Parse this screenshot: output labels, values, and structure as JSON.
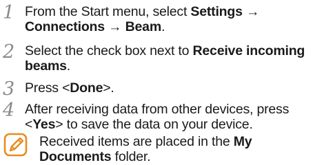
{
  "steps": [
    {
      "number": "1",
      "parts": [
        {
          "text": "From the Start menu, select ",
          "bold": false
        },
        {
          "text": "Settings",
          "bold": true
        },
        {
          "text": " → ",
          "bold": false
        },
        {
          "text": "Connections",
          "bold": true
        },
        {
          "text": " → ",
          "bold": false
        },
        {
          "text": "Beam",
          "bold": true
        },
        {
          "text": ".",
          "bold": false
        }
      ]
    },
    {
      "number": "2",
      "parts": [
        {
          "text": "Select the check box next to ",
          "bold": false
        },
        {
          "text": "Receive incoming beams",
          "bold": true
        },
        {
          "text": ".",
          "bold": false
        }
      ]
    },
    {
      "number": "3",
      "parts": [
        {
          "text": "Press <",
          "bold": false
        },
        {
          "text": "Done",
          "bold": true
        },
        {
          "text": ">.",
          "bold": false
        }
      ]
    },
    {
      "number": "4",
      "parts": [
        {
          "text": "After receiving data from other devices, press <",
          "bold": false
        },
        {
          "text": "Yes",
          "bold": true
        },
        {
          "text": "> to save the data on your device.",
          "bold": false
        }
      ]
    }
  ],
  "note": {
    "icon": "note-pencil-icon",
    "icon_color": "#e98a1f",
    "parts": [
      {
        "text": "Received items are placed in the ",
        "bold": false
      },
      {
        "text": "My Documents",
        "bold": true
      },
      {
        "text": " folder.",
        "bold": false
      }
    ]
  }
}
